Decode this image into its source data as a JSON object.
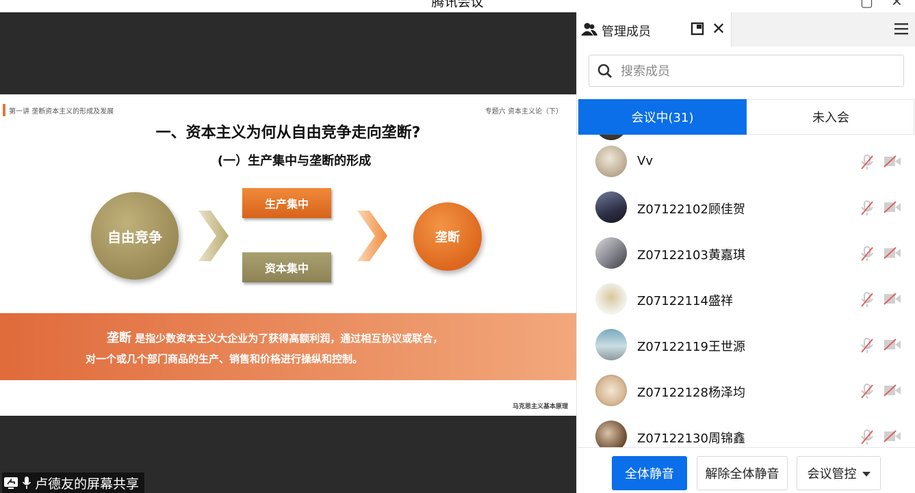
{
  "window": {
    "title": "腾讯会议"
  },
  "slide": {
    "header_left": "第一讲  垄断资本主义的形成及发展",
    "header_right": "专题六  资本主义论（下）",
    "title": "一、资本主义为何从自由竞争走向垄断?",
    "subtitle": "(一）生产集中与垄断的形成",
    "circle_left": "自由竞争",
    "box_top": "生产集中",
    "box_bottom": "资本集中",
    "circle_right": "垄断",
    "band_keyword": "垄断",
    "band_line1": "是指少数资本主义大企业为了获得高额利润，通过相互协议或联合，",
    "band_line2": "对一个或几个部门商品的生产、销售和价格进行操纵和控制。",
    "footer": "马克思主义基本原理"
  },
  "share_label": "卢德友的屏幕共享",
  "panel": {
    "tab_label": "管理成员",
    "search_placeholder": "搜索成员",
    "tab_in_meeting": "会议中(31)",
    "tab_not_joined": "未入会",
    "members": [
      {
        "name": "Vv"
      },
      {
        "name": "Z07122102顾佳贺"
      },
      {
        "name": "Z07122103黄嘉琪"
      },
      {
        "name": "Z07122114盛祥"
      },
      {
        "name": "Z07122119王世源"
      },
      {
        "name": "Z07122128杨泽均"
      },
      {
        "name": "Z07122130周锦鑫"
      }
    ],
    "buttons": {
      "mute_all": "全体静音",
      "unmute_all": "解除全体静音",
      "meeting_control": "会议管控"
    }
  },
  "colors": {
    "accent": "#0a6fe8",
    "slide_orange": "#e06b3b",
    "slide_olive": "#8d8356"
  }
}
